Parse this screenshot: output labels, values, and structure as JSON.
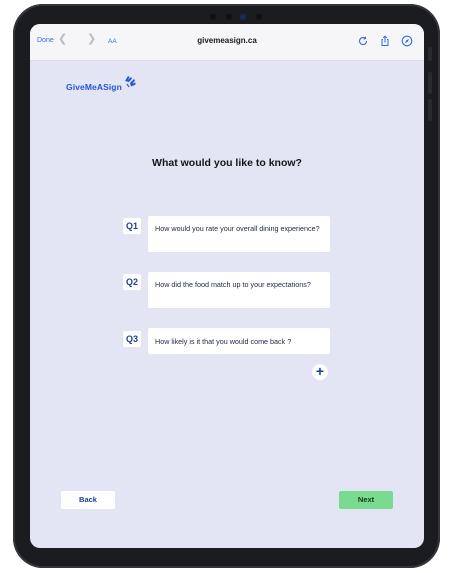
{
  "browser": {
    "done_label": "Done",
    "back_icon": "chevron-left-icon",
    "forward_icon": "chevron-right-icon",
    "text_size_label": "AA",
    "url": "givemeasign.ca",
    "reload_icon": "reload-icon",
    "share_icon": "share-icon",
    "compass_icon": "compass-icon"
  },
  "brand": {
    "name": "GiveMeASign",
    "color": "#2457d6"
  },
  "page": {
    "heading": "What would you like to know?"
  },
  "questions": [
    {
      "label": "Q1",
      "text": "How would you rate your overall dining experience?"
    },
    {
      "label": "Q2",
      "text": "How did the food match up to your expectations?"
    },
    {
      "label": "Q3",
      "text": "How likely is it that you would come back ?"
    }
  ],
  "actions": {
    "add_icon": "plus-icon",
    "add_symbol": "+",
    "back_label": "Back",
    "next_label": "Next",
    "next_color": "#79db8f"
  }
}
